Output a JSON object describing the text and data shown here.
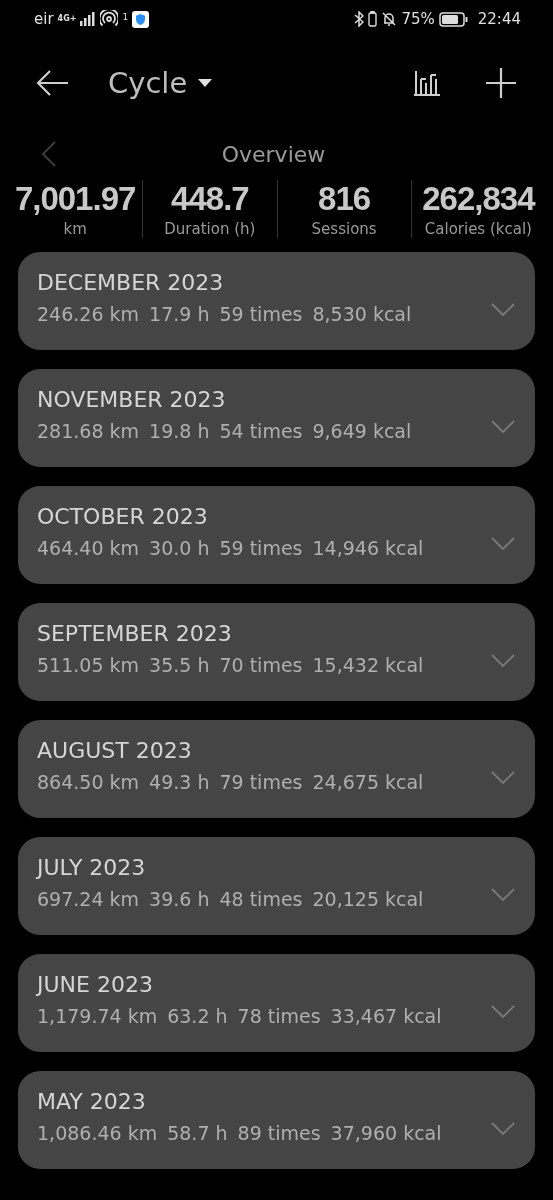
{
  "status_bar": {
    "carrier": "eir",
    "network": "4G+",
    "hotspot_count": "1",
    "battery_percent": "75%",
    "time": "22:44"
  },
  "header": {
    "title": "Cycle"
  },
  "overview": {
    "title": "Overview",
    "stats": [
      {
        "value": "7,001.97",
        "label": "km"
      },
      {
        "value": "448.7",
        "label": "Duration (h)"
      },
      {
        "value": "816",
        "label": "Sessions"
      },
      {
        "value": "262,834",
        "label": "Calories (kcal)"
      }
    ]
  },
  "months": [
    {
      "title": "DECEMBER 2023",
      "stats": [
        "246.26 km",
        "17.9 h",
        "59 times",
        "8,530 kcal"
      ],
      "expanded": false
    },
    {
      "title": "NOVEMBER 2023",
      "stats": [
        "281.68 km",
        "19.8 h",
        "54 times",
        "9,649 kcal"
      ],
      "expanded": false
    },
    {
      "title": "OCTOBER 2023",
      "stats": [
        "464.40 km",
        "30.0 h",
        "59 times",
        "14,946 kcal"
      ],
      "expanded": false
    },
    {
      "title": "SEPTEMBER 2023",
      "stats": [
        "511.05 km",
        "35.5 h",
        "70 times",
        "15,432 kcal"
      ],
      "expanded": false
    },
    {
      "title": "AUGUST 2023",
      "stats": [
        "864.50 km",
        "49.3 h",
        "79 times",
        "24,675 kcal"
      ],
      "expanded": false
    },
    {
      "title": "JULY 2023",
      "stats": [
        "697.24 km",
        "39.6 h",
        "48 times",
        "20,125 kcal"
      ],
      "expanded": false
    },
    {
      "title": "JUNE 2023",
      "stats": [
        "1,179.74 km",
        "63.2 h",
        "78 times",
        "33,467 kcal"
      ],
      "expanded": false
    },
    {
      "title": "MAY 2023",
      "stats": [
        "1,086.46 km",
        "58.7 h",
        "89 times",
        "37,960 kcal"
      ],
      "expanded": false
    }
  ]
}
